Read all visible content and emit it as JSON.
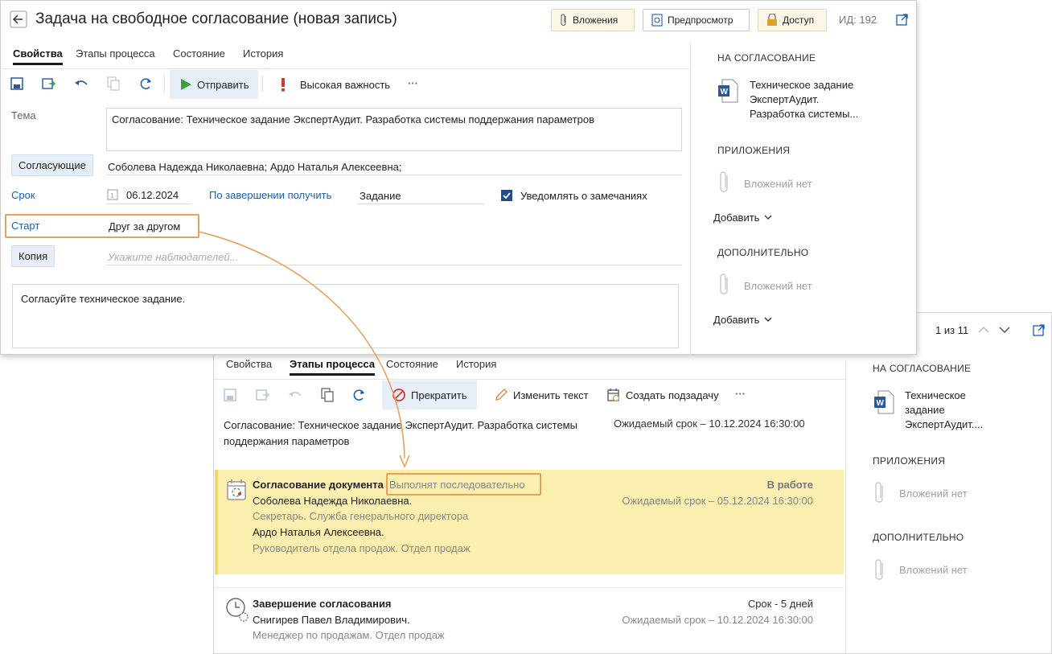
{
  "front": {
    "title": "Задача на свободное согласование (новая запись)",
    "header_buttons": {
      "attachments": "Вложения",
      "preview": "Предпросмотр",
      "access": "Доступ"
    },
    "id_label": "ИД: 192",
    "tabs": [
      "Свойства",
      "Этапы процесса",
      "Состояние",
      "История"
    ],
    "toolbar": {
      "send": "Отправить",
      "importance": "Высокая важность",
      "more": "···"
    },
    "fields": {
      "subject_label": "Тема",
      "subject_value": "Согласование: Техническое задание ЭкспертАудит. Разработка системы поддержания параметров",
      "approvers_label": "Согласующие",
      "approvers_value": "Соболева Надежда Николаевна; Ардо Наталья Алексеевна;",
      "due_label": "Срок",
      "due_value": "06.12.2024",
      "on_complete_label": "По завершении получить",
      "on_complete_value": "Задание",
      "notify_label": "Уведомлять о замечаниях",
      "notify_checked": true,
      "start_label": "Старт",
      "start_value": "Друг за другом",
      "copy_label": "Копия",
      "copy_placeholder": "Укажите наблюдателей...",
      "comment": "Согласуйте техническое задание."
    },
    "side": {
      "for_approval": "НА СОГЛАСОВАНИЕ",
      "doc_title": "Техническое задание ЭкспертАудит. Разработка системы...",
      "attachments": "ПРИЛОЖЕНИЯ",
      "no_attachments": "Вложений нет",
      "add": "Добавить",
      "additional": "ДОПОЛНИТЕЛЬНО",
      "no_attachments_2": "Вложений нет",
      "add_2": "Добавить"
    }
  },
  "back": {
    "pager": "1 из 11",
    "tabs": [
      "Свойства",
      "Этапы процесса",
      "Состояние",
      "История"
    ],
    "toolbar": {
      "stop": "Прекратить",
      "edit_text": "Изменить текст",
      "subtask": "Создать подзадачу",
      "more": "···"
    },
    "summary": {
      "title": "Согласование: Техническое задание ЭкспертАудит. Разработка системы поддержания параметров",
      "expected": "Ожидаемый срок – 10.12.2024 16:30:00"
    },
    "stages": [
      {
        "title": "Согласование документа",
        "mode": "Выполнят последовательно",
        "status": "В работе",
        "expected": "Ожидаемый срок – 05.12.2024 16:30:00",
        "people": [
          {
            "name": "Соболева Надежда Николаевна.",
            "role": "Секретарь. Служба генерального директора"
          },
          {
            "name": "Ардо Наталья Алексеевна.",
            "role": "Руководитель отдела продаж. Отдел продаж"
          }
        ]
      },
      {
        "title": "Завершение согласования",
        "status": "Срок - 5 дней",
        "expected": "Ожидаемый срок – 10.12.2024 16:30:00",
        "people": [
          {
            "name": "Снигирев Павел Владимирович.",
            "role": "Менеджер по продажам. Отдел продаж"
          }
        ]
      }
    ],
    "side": {
      "for_approval": "НА СОГЛАСОВАНИЕ",
      "doc_title": "Техническое задание ЭкспертАудит....",
      "attachments": "ПРИЛОЖЕНИЯ",
      "no_attachments": "Вложений нет",
      "additional": "ДОПОЛНИТЕЛЬНО",
      "no_attachments_2": "Вложений нет"
    }
  },
  "colors": {
    "accent_orange": "#e9a15a",
    "highlight": "#fbefb0",
    "link": "#1a5fb4",
    "send_green": "#3aa13a"
  }
}
